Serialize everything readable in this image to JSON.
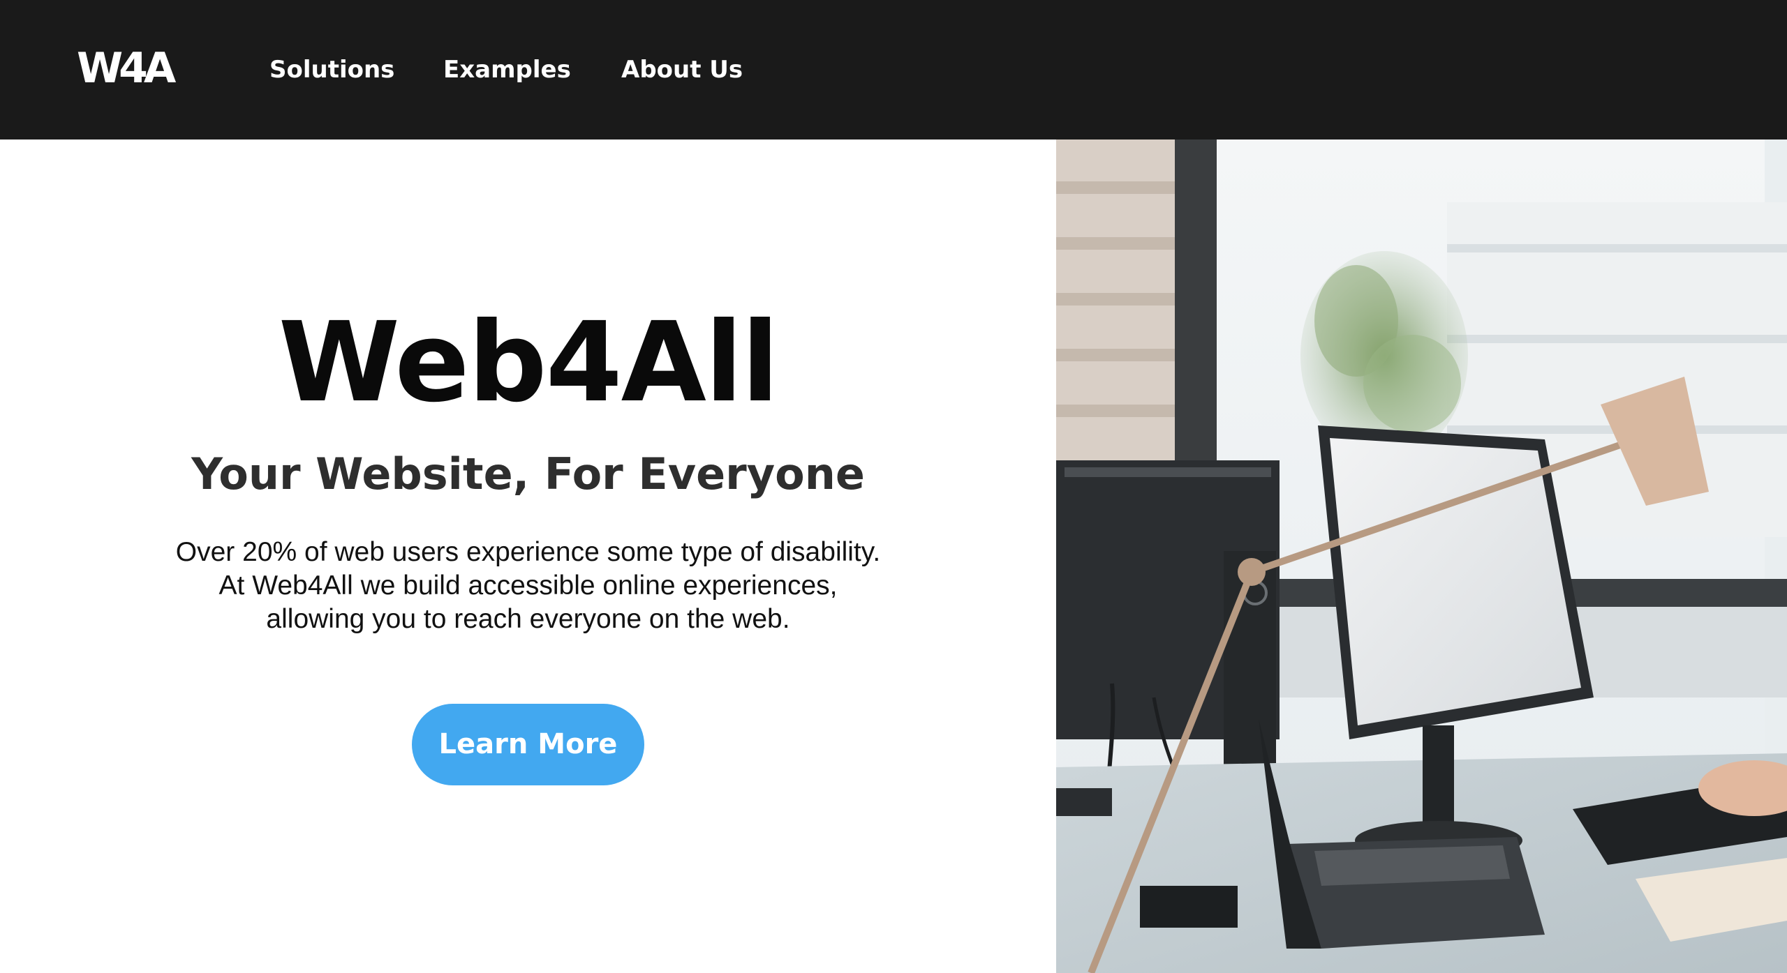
{
  "nav": {
    "logo_text": "W4A",
    "links": [
      {
        "label": "Solutions"
      },
      {
        "label": "Examples"
      },
      {
        "label": "About Us"
      }
    ]
  },
  "hero": {
    "title": "Web4All",
    "subtitle": "Your Website, For Everyone",
    "description_lines": [
      "Over 20% of web users experience some type of disability.",
      "At Web4All we build accessible online experiences,",
      "allowing you to reach everyone on the web."
    ],
    "cta_label": "Learn More"
  },
  "colors": {
    "navbar_bg": "#1a1a1a",
    "cta_bg": "#42a8f0",
    "text_dark": "#0a0a0a"
  }
}
